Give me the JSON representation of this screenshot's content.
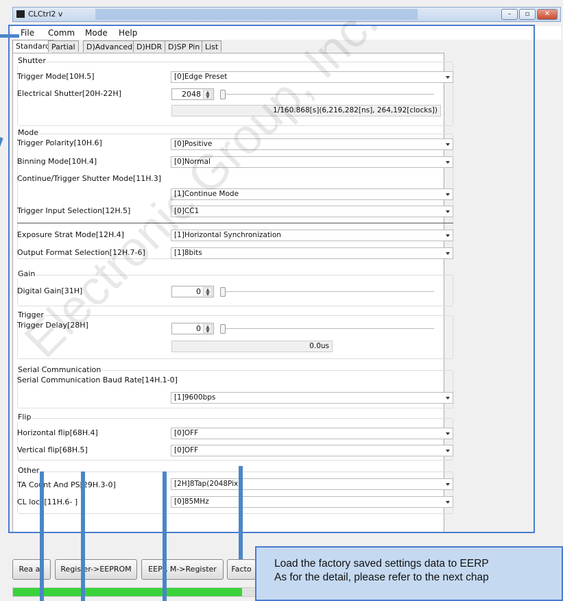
{
  "window": {
    "title": "CLCtrl2 v",
    "minimize": "–",
    "maximize": "▫",
    "close": "✕"
  },
  "menu": [
    "File",
    "Comm",
    "Mode",
    "Help"
  ],
  "tabs": [
    "Standard",
    "Partial",
    "D)Advanced",
    "D)HDR",
    "D)SP Pin",
    "List"
  ],
  "shutter": {
    "title": "Shutter",
    "trigger_mode_label": "Trigger Mode[10H.5]",
    "trigger_mode_value": "[0]Edge Preset",
    "electrical_shutter_label": "Electrical Shutter[20H-22H]",
    "electrical_shutter_value": "2048",
    "electrical_shutter_readout": "1/160.868[s](6,216,282[ns], 264,192[clocks])"
  },
  "mode": {
    "title": "Mode",
    "trigger_polarity_label": "Trigger Polarity[10H.6]",
    "trigger_polarity_value": "[0]Positive",
    "binning_label": "Binning Mode[10H.4]",
    "binning_value": "[0]Normal",
    "continue_label": "Continue/Trigger Shutter Mode[11H.3]",
    "continue_value": "[1]Continue Mode",
    "trigger_input_label": "Trigger Input Selection[12H.5]",
    "trigger_input_value": "[0]CC1",
    "exposure_label": "Exposure Strat Mode[12H.4]",
    "exposure_value": "[1]Horizontal Synchronization",
    "output_format_label": "Output Format Selection[12H.7-6]",
    "output_format_value": "[1]8bits"
  },
  "gain": {
    "title": "Gain",
    "digital_gain_label": "Digital Gain[31H]",
    "digital_gain_value": "0"
  },
  "trigger": {
    "title": "Trigger",
    "delay_label": "Trigger Delay[28H]",
    "delay_value": "0",
    "delay_readout": "0.0us"
  },
  "serial": {
    "title": "Serial Communication",
    "baud_label": "Serial Communication Baud Rate[14H.1-0]",
    "baud_value": "[1]9600bps"
  },
  "flip": {
    "title": "Flip",
    "horizontal_label": "Horizontal flip[68H.4]",
    "horizontal_value": "[0]OFF",
    "vertical_label": "Vertical flip[68H.5]",
    "vertical_value": "[0]OFF"
  },
  "other": {
    "title": "Other",
    "tap_label": "TA  Count And  PS[29H.3-0]",
    "tap_value": "[2H]8Tap(2048Pix  )",
    "clock_label": "CL  lock[11H.6-  ]",
    "clock_value": "[0]85MHz"
  },
  "buttons": {
    "readall": "Rea  all",
    "reg_to_eeprom": "Regis  er->EEPROM",
    "eeprom_to_reg": "EEPR  M->Register",
    "factory": "Facto"
  },
  "progress": {
    "fraction": 0.55
  },
  "callout": {
    "line1": "Load the factory saved settings data to EERP",
    "line2": "As for the detail, please refer to the next chap"
  },
  "watermark": "Electronic Group, Inc."
}
